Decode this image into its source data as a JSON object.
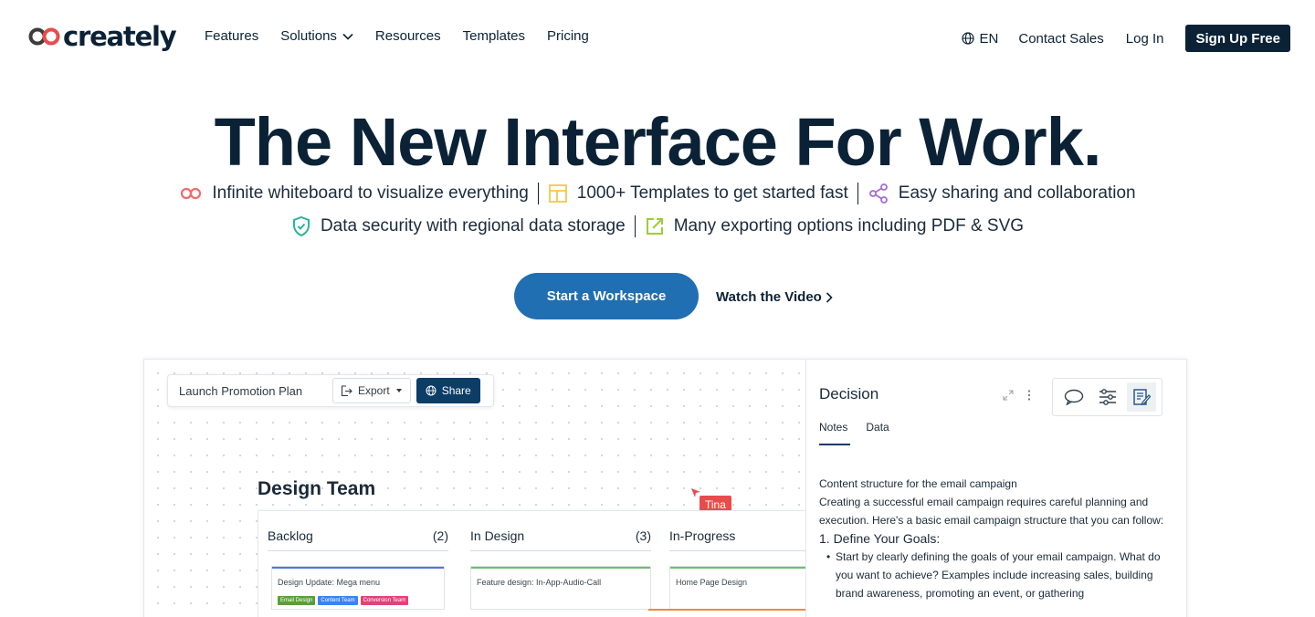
{
  "brand": {
    "name": "creately",
    "colors": {
      "navy": "#0b2236",
      "blue": "#1f6fb2",
      "red": "#e74c4c",
      "coral": "#f06b6b"
    }
  },
  "nav": {
    "links": [
      {
        "label": "Features",
        "icon": null
      },
      {
        "label": "Solutions",
        "icon": "chevron-down-icon"
      },
      {
        "label": "Resources",
        "icon": null
      },
      {
        "label": "Templates",
        "icon": null
      },
      {
        "label": "Pricing",
        "icon": null
      }
    ],
    "language": "EN",
    "contact_sales": "Contact Sales",
    "log_in": "Log In",
    "sign_up": "Sign Up Free"
  },
  "hero": {
    "title": "The New Interface For Work.",
    "features_row1": [
      {
        "text": "Infinite whiteboard to visualize everything",
        "icon": "infinity-icon"
      },
      {
        "text": "1000+ Templates to get started fast",
        "icon": "template-icon"
      },
      {
        "text": "Easy sharing and collaboration",
        "icon": "share-icon"
      }
    ],
    "features_row2": [
      {
        "text": "Data security with regional data storage",
        "icon": "shield-icon"
      },
      {
        "text": "Many exporting options including PDF & SVG",
        "icon": "export-icon"
      }
    ],
    "cta_primary": "Start a Workspace",
    "cta_secondary": "Watch the Video"
  },
  "preview": {
    "toolbar": {
      "doc_name": "Launch Promotion Plan",
      "export": "Export",
      "share": "Share"
    },
    "team_title": "Design Team",
    "cursor_user": "Tina",
    "columns": [
      {
        "title": "Backlog",
        "count": "(2)",
        "card": "Design Update: Mega menu",
        "accent": "#4a78d8",
        "tags": [
          {
            "label": "Email Design",
            "color": "#5a9e3a"
          },
          {
            "label": "Content Team",
            "color": "#3b82f6"
          },
          {
            "label": "Conversion Team",
            "color": "#e0437a"
          }
        ]
      },
      {
        "title": "In Design",
        "count": "(3)",
        "card": "Feature design: In-App-Audio-Call",
        "accent": "#6cbf6b",
        "tags": []
      },
      {
        "title": "In-Progress",
        "count": "",
        "card": "Home Page Design",
        "accent": "#6cbf6b",
        "tags": []
      }
    ],
    "panel": {
      "title": "Decision",
      "tabs": [
        "Notes",
        "Data"
      ],
      "notes_intro": "Content structure for the email campaign",
      "notes_para": "Creating a successful email campaign requires careful planning and execution. Here's a basic email campaign structure that you can follow:",
      "notes_heading": "1. Define Your Goals:",
      "notes_bullet": "Start by clearly defining the goals of your email campaign. What do you want to achieve? Examples include increasing sales, building brand awareness, promoting an event, or gathering"
    }
  }
}
